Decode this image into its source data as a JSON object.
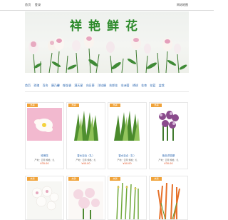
{
  "topbar": {
    "links": [
      "首页",
      "登录"
    ],
    "right_text": "网站地图"
  },
  "brand": {
    "title": "祥艳鲜花"
  },
  "nav": {
    "items": [
      "首页",
      "玫瑰",
      "百合",
      "康乃馨",
      "郁金香",
      "满天星",
      "向日葵",
      "洋桔梗",
      "扶郎花",
      "非洲菊",
      "绣球",
      "花束",
      "花篮",
      "盆栽"
    ]
  },
  "products_row1": [
    {
      "tag": "热销",
      "name": "玫瑰花",
      "meta": "产地：云南  规格：扎",
      "price": "¥35.00"
    },
    {
      "tag": "热销",
      "name": "香水百合（扎）",
      "meta": "产地：云南  规格：扎",
      "price": "¥40.00"
    },
    {
      "tag": "热销",
      "name": "香水百合（扎）",
      "meta": "产地：云南  规格：扎",
      "price": "¥40.00"
    },
    {
      "tag": "热销",
      "name": "紫色洋桔梗",
      "meta": "产地：云南  规格：扎",
      "price": "¥30.00"
    }
  ],
  "products_row2": [
    {
      "tag": "热销"
    },
    {
      "tag": "热销"
    },
    {
      "tag": "热销"
    },
    {
      "tag": "热销"
    }
  ]
}
